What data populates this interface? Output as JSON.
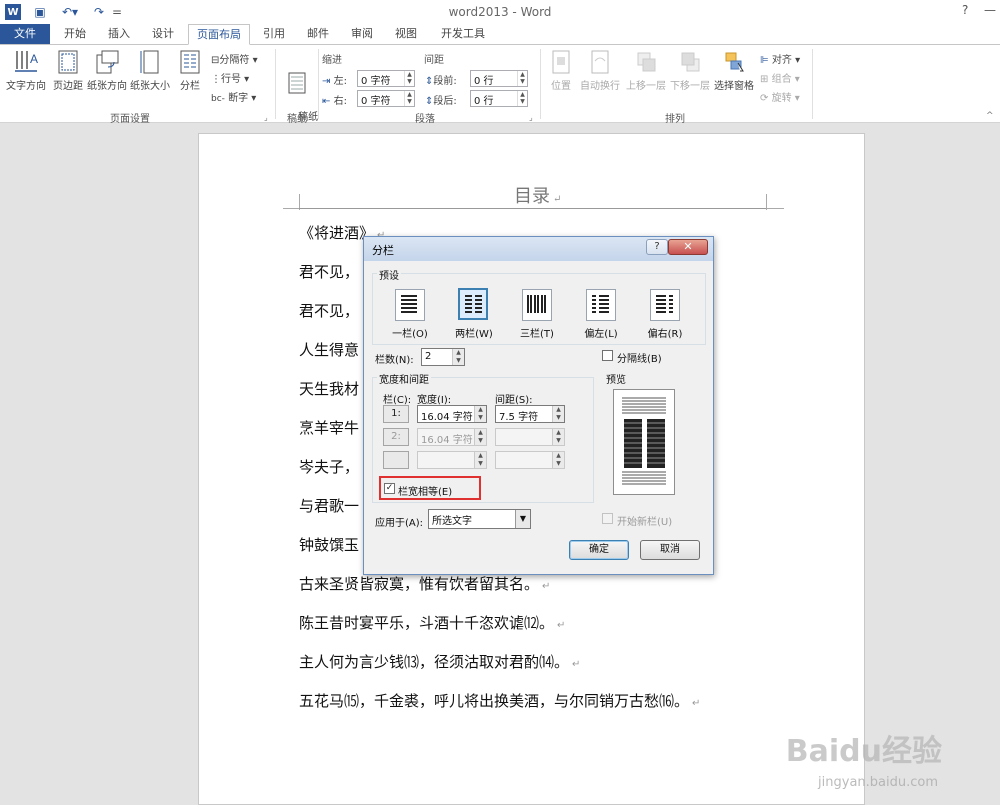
{
  "app": {
    "window_title": "word2013 - Word",
    "help": "?",
    "minimize": "—"
  },
  "tabs": [
    "文件",
    "开始",
    "插入",
    "设计",
    "页面布局",
    "引用",
    "邮件",
    "审阅",
    "视图",
    "开发工具"
  ],
  "ribbon": {
    "page_setup": {
      "text_direction": "文字方向",
      "margins": "页边距",
      "orientation": "纸张方向",
      "size": "纸张大小",
      "columns": "分栏",
      "breaks": "分隔符",
      "line_numbers": "行号",
      "hyphenation": "断字",
      "group_label": "页面设置"
    },
    "manuscript": {
      "label": "稿纸\n设置",
      "group_label": "稿纸"
    },
    "paragraph": {
      "indent": "缩进",
      "spacing": "间距",
      "left_label": "左:",
      "right_label": "右:",
      "left_value": "0 字符",
      "right_value": "0 字符",
      "before_label": "段前:",
      "after_label": "段后:",
      "before_value": "0 行",
      "after_value": "0 行",
      "group_label": "段落"
    },
    "arrange": {
      "position": "位置",
      "wrap_text": "自动换行",
      "bring_forward": "上移一层",
      "send_backward": "下移一层",
      "selection_pane": "选择窗格",
      "align": "对齐",
      "group": "组合",
      "rotate": "旋转",
      "group_label": "排列"
    }
  },
  "document": {
    "header": "目录",
    "paragraphs": [
      "《将进酒》",
      "君不见，",
      "君不见，",
      "人生得意",
      "天生我材",
      "烹羊宰牛",
      "岑夫子，",
      "与君歌一",
      "钟鼓馔玉",
      "古来圣贤皆寂寞，惟有饮者留其名。",
      "陈王昔时宴平乐，斗酒十千恣欢谑⑿。",
      "主人何为言少钱⒀，径须沽取对君酌⒁。",
      "五花马⒂，千金裘，呼儿将出换美酒，与尔同销万古愁⒃。"
    ]
  },
  "dialog": {
    "title": "分栏",
    "help": "?",
    "close": "✕",
    "presets_label": "预设",
    "presets": [
      "一栏(O)",
      "两栏(W)",
      "三栏(T)",
      "偏左(L)",
      "偏右(R)"
    ],
    "column_count_label": "栏数(N):",
    "column_count": "2",
    "line_between_label": "分隔线(B)",
    "width_spacing_label": "宽度和间距",
    "col_header": "栏(C):",
    "width_header": "宽度(I):",
    "spacing_header": "间距(S):",
    "rows": [
      {
        "num": "1:",
        "width": "16.04 字符",
        "spacing": "7.5 字符"
      },
      {
        "num": "2:",
        "width": "16.04 字符",
        "spacing": ""
      },
      {
        "num": "",
        "width": "",
        "spacing": ""
      }
    ],
    "equal_width_label": "栏宽相等(E)",
    "preview_label": "预览",
    "apply_to_label": "应用于(A):",
    "apply_to_value": "所选文字",
    "start_new_column_label": "开始新栏(U)",
    "ok": "确定",
    "cancel": "取消"
  },
  "watermark": {
    "brand": "Baidu经验",
    "url": "jingyan.baidu.com"
  },
  "colors": {
    "accent": "#2b579a",
    "highlight": "#e03030"
  }
}
